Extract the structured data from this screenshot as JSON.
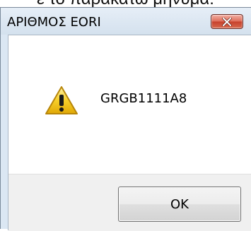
{
  "background_text": "ε το παρακάτω μήνυμα:",
  "dialog": {
    "title": "ΑΡΙΘΜΟΣ EORI",
    "close_icon": "close-x-icon",
    "message_icon": "warning-icon",
    "message": "GRGB1111A8",
    "ok_label": "OK"
  },
  "colors": {
    "titlebar": "#dbe7f3",
    "close_button": "#c7412d",
    "content_bg": "#ffffff",
    "footer_bg": "#f0f0f0",
    "warning_yellow": "#f5c518"
  }
}
